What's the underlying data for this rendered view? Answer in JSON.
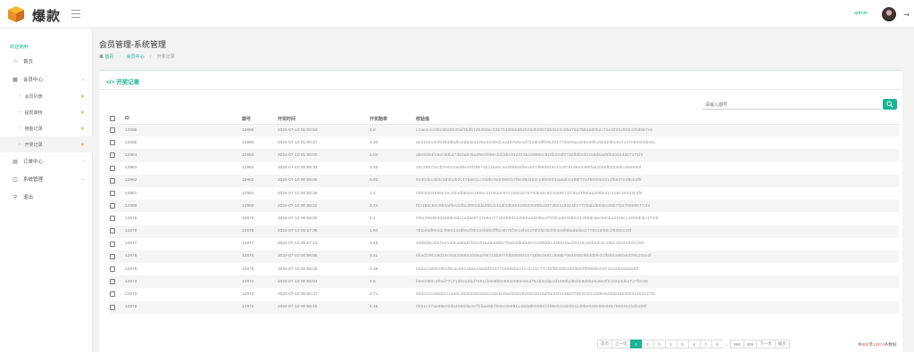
{
  "app": {
    "brand": "爆款",
    "user": "admin"
  },
  "sidebar": {
    "welcome": "欢迎使用",
    "items": {
      "home": {
        "label": "首页",
        "icon": "home-icon"
      },
      "member": {
        "label": "会员中心",
        "icon": "grid-icon"
      },
      "order": {
        "label": "订单中心",
        "icon": "chart-icon"
      },
      "system": {
        "label": "系统管理",
        "icon": "settings-icon"
      },
      "logout": {
        "label": "退出",
        "icon": "key-icon"
      }
    },
    "subitems": [
      {
        "label": "会员列表"
      },
      {
        "label": "提现审核"
      },
      {
        "label": "佣金记录"
      },
      {
        "label": "开奖记录"
      }
    ]
  },
  "page": {
    "title": "会员管理-系统管理",
    "breadcrumb": [
      "首页",
      "会员中心",
      "开奖记录"
    ]
  },
  "panel": {
    "title": "开奖记录",
    "search_placeholder": "请输入期号"
  },
  "table": {
    "headers": [
      "ID",
      "期号",
      "开奖时间",
      "开奖赔率",
      "校验值"
    ],
    "rows": [
      [
        "12986",
        "12986",
        "2024-07-10 01:00:53",
        "4.9",
        "c1ae4cecbbc5629930af3bdb7d8392ec5357643665862026d50067db42e1cd6a7637564a8052c71e3225292542bd067ee"
      ],
      [
        "12985",
        "12985",
        "2024-07-10 01:00:27",
        "3.33",
        "ae3182160f02538bdbced5384425e420fedca34d756e1d7216b5ffb8530177da06ae4e5ea0fcc5b2e3bc9a7147e8e6bbb42c"
      ],
      [
        "12984",
        "12984",
        "2024-07-10 01:00:00",
        "4.94",
        "a6e8264f46ec6db47d53a945a3963fe8ecb2f3be312413a16560ec616b204f07d2fbf03b07a9d5ad5f52064d2b7171f2"
      ],
      [
        "12983",
        "12983",
        "2024-07-10 00:59:33",
        "3.45",
        "34c29572ccb7e61c0ed6e49f39673211be5c4e499565f9ecbf7d69d929c41c979196e2490faa204bfb0d385188ee68f"
      ],
      [
        "12982",
        "12982",
        "2024-07-10 00:59:06",
        "5.61",
        "9430decdd4c3d302bd1479ae11c7d2bc9eb069cb7f9ed9d482ce6b00044a5ab5498f77a75630e2314f8507ed8cb3f5"
      ],
      [
        "12981",
        "12981",
        "2024-07-10 00:58:38",
        "1.4",
        "0f803de466be1ec4b4db60ee189ec41083ae971158ecb7879d5a5c6d4a48571fc9a21f9daa300fe41cce5c2910303f5"
      ],
      [
        "12980",
        "12980",
        "2024-07-10 00:58:22",
        "2.74",
        "f62155c5ec064a0bed2fbc2982dda36bdc113f40b65529020585ba337382118314b77700abdb93ec06b7f2e76089577cf4"
      ],
      [
        "12979",
        "12979",
        "2024-07-10 00:58:00",
        "4.1",
        "5f61296382d2695b8dc1ed8e8727e9a7771b29bd22cb52a43288ed753fca3032bfe31396dcdece0c5a3416cc4483dcbc1734f"
      ],
      [
        "12978",
        "12978",
        "2024-07-10 00:57:35",
        "1.84",
        "7b2a5df9eedcf95e2348b52f3602eb0b0fff0c9b75f3e16fe0379f2fd1bd384e8f9bad5da11778215f88c29360c33f"
      ],
      [
        "12977",
        "12977",
        "2024-07-10 00:57:13",
        "3.48",
        "3a86f963de7ee14dca55a97f02c016a6a09b078a0d3bd6d07e29f8261336519acb011514ebddc5c18bc184319781f68"
      ],
      [
        "12976",
        "12976",
        "2024-07-10 00:56:56",
        "5.41",
        "6bad1f9028d33c555238653dd5a295714b3070f50598318716b63e91c888b708400829bdd0fe31fbbbba80aa409a20acdf"
      ],
      [
        "12975",
        "12975",
        "2024-07-10 00:56:29",
        "4.35",
        "93aac18051902f9cacd82166e23ed8f5157716006be11cc2c0cc77c40f6b40f6250f82fdf99606cb9741e45b8af4d8ff"
      ],
      [
        "12974",
        "12974",
        "2024-07-10 00:56:04",
        "4.5",
        "b0e0360c4f0af77c71d92a2bd7e91cb9e8b0e584e582e5ed751b42dacaf1690bd8cbb8d0be5a9e3f2c02a4d04737f0c55"
      ],
      [
        "12973",
        "12973",
        "2024-07-10 00:55:37",
        "2.71",
        "60d41e106e8e21adac4be53250206e145d449a290628209e3e25df9e32f4168637504c2f2c0d8e942b5495d0044463147f5"
      ],
      [
        "12972",
        "12972",
        "2024-07-10 00:55:15",
        "4.16",
        "0b51c37aa59e02da40863ac57f1baa55790ec65581148da8b058a7409e6cea0251140be93de68e0e57568252b2b169f"
      ]
    ]
  },
  "pagination": {
    "first": "首页",
    "prev": "上一页",
    "pages": [
      "1",
      "2",
      "3",
      "4",
      "5",
      "6",
      "7",
      "8"
    ],
    "ellipsis": "...",
    "tail": [
      "864",
      "865"
    ],
    "next": "下一页",
    "last": "尾页",
    "current": "1",
    "total_prefix": "共",
    "total_pages": "865",
    "total_mid": "页",
    "total_records": "12974",
    "total_suffix": "条数据"
  },
  "colors": {
    "accent": "#1ab394",
    "star": "#f8ac59",
    "total_highlight": "#ed5565"
  }
}
